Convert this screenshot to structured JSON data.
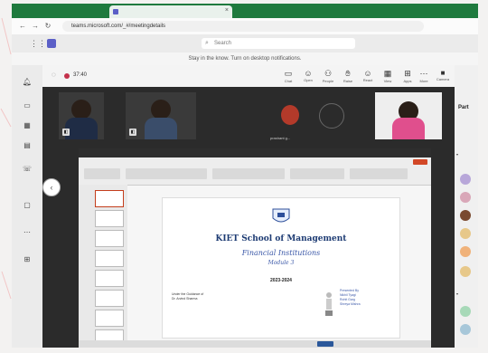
{
  "browser": {
    "tab_title": "",
    "url": "teams.microsoft.com/_#/meetingdetails"
  },
  "teams": {
    "search_placeholder": "Search",
    "notification": "Stay in the know. Turn on desktop notifications."
  },
  "meeting": {
    "timer": "37:40",
    "controls": [
      {
        "icon": "chat-icon",
        "label": "Chat"
      },
      {
        "icon": "people-icon",
        "label": "Open"
      },
      {
        "icon": "participants-icon",
        "label": "People"
      },
      {
        "icon": "raise-hand-icon",
        "label": "Raise"
      },
      {
        "icon": "react-icon",
        "label": "React"
      },
      {
        "icon": "view-icon",
        "label": "View"
      },
      {
        "icon": "apps-icon",
        "label": "Apps"
      },
      {
        "icon": "more-icon",
        "label": "More"
      }
    ],
    "camera_label": "Camera",
    "participant_name": "prashant g..."
  },
  "slide": {
    "title": "KIET School of Management",
    "subtitle": "Financial Institutions",
    "module": "Module 3",
    "year": "2023-2024",
    "left_text_1": "Under the Guidance of",
    "left_text_2": "Dr. Arvind Sharma",
    "right_text_1": "Presented By",
    "right_text_2": "Nikhil Tyagi",
    "right_text_3": "Rohit Garg",
    "right_text_4": "Shreya Mishra"
  },
  "right_panel": {
    "title": "Part"
  }
}
